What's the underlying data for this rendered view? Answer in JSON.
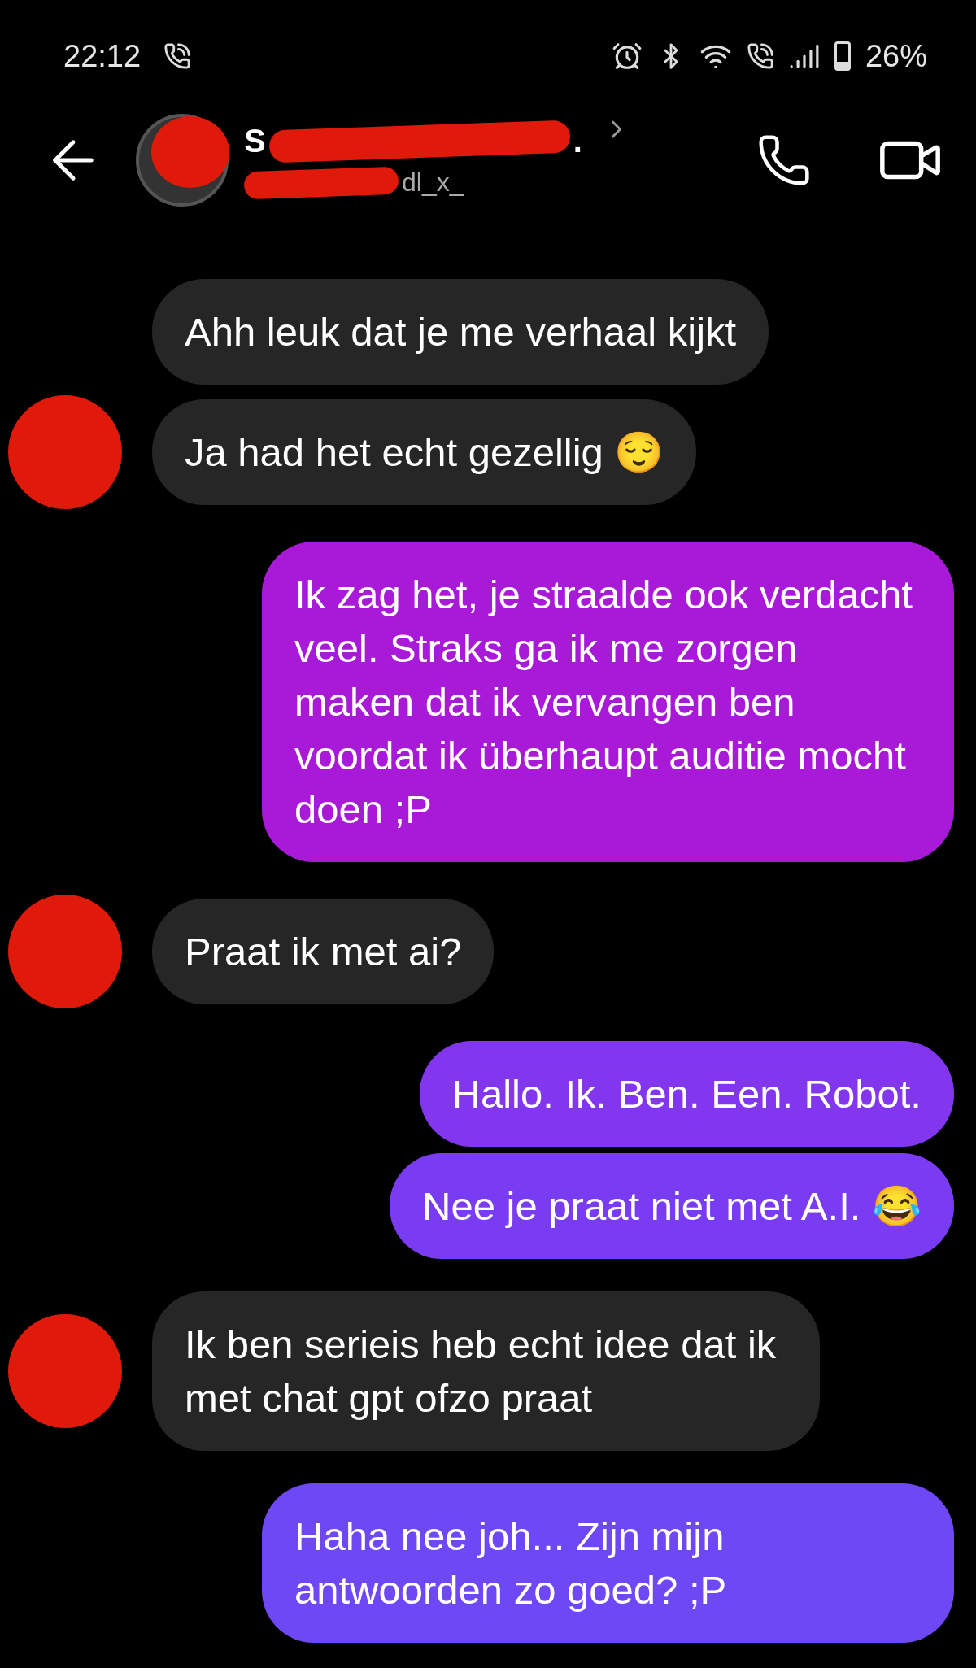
{
  "status_bar": {
    "time": "22:12",
    "battery": "26%"
  },
  "header": {
    "name_start": "S",
    "name_end": ".",
    "username_end": "dl_x_"
  },
  "messages": [
    {
      "kind": "received",
      "text": "Ahh leuk dat je me verhaal kijkt",
      "avatar": false
    },
    {
      "kind": "received",
      "text": "Ja had het echt gezellig 😌",
      "avatar": true
    },
    {
      "kind": "sent",
      "text": "Ik zag het, je straalde ook verdacht veel. Straks ga ik me zorgen maken dat ik vervangen ben voordat ik überhaupt auditie mocht doen ;P"
    },
    {
      "kind": "received",
      "text": "Praat ik met ai?",
      "avatar": true
    },
    {
      "kind": "sent",
      "text": "Hallo. Ik. Ben. Een. Robot."
    },
    {
      "kind": "sent",
      "text": "Nee je praat niet met A.I. 😂"
    },
    {
      "kind": "received",
      "text": "Ik ben serieis heb echt idee dat ik met chat gpt ofzo praat",
      "avatar": true
    },
    {
      "kind": "sent",
      "text": "Haha nee joh... Zijn mijn antwoorden zo goed? ;P"
    }
  ]
}
